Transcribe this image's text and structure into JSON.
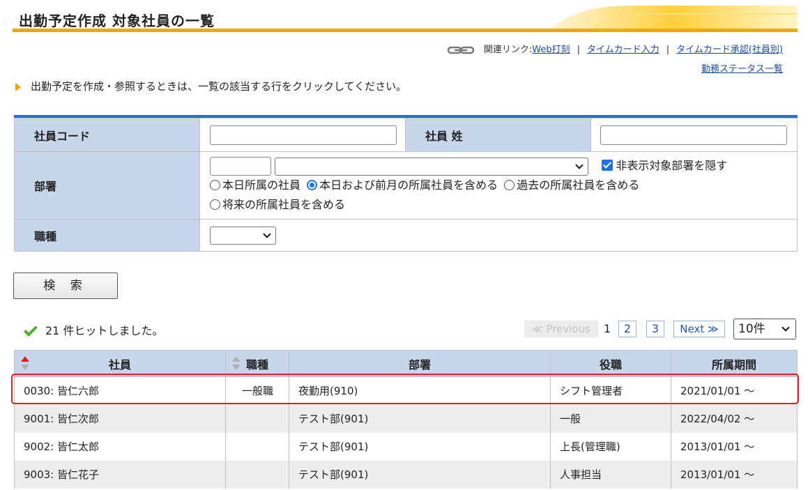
{
  "header": {
    "title": "出勤予定作成 対象社員の一覧"
  },
  "related_links": {
    "label": "関連リンク:",
    "items": [
      "Web打刻",
      "タイムカード入力",
      "タイムカード承認(社員別)",
      "勤務ステータス一覧"
    ],
    "separator": "|"
  },
  "instruction": "出勤予定を作成・参照するときは、一覧の該当する行をクリックしてください。",
  "search_form": {
    "employee_code_label": "社員コード",
    "employee_code_value": "",
    "employee_surname_label": "社員 姓",
    "employee_surname_value": "",
    "department_label": "部署",
    "department_code_value": "",
    "department_select_value": "",
    "hide_hidden_departments": {
      "label": "非表示対象部署を隠す",
      "checked": true
    },
    "membership_options": [
      {
        "label": "本日所属の社員",
        "selected": false
      },
      {
        "label": "本日および前月の所属社員を含める",
        "selected": true
      },
      {
        "label": "過去の所属社員を含める",
        "selected": false
      },
      {
        "label": "将来の所属社員を含める",
        "selected": false
      }
    ],
    "job_type_label": "職種",
    "job_type_value": "",
    "search_button": "検 索"
  },
  "results": {
    "hit_text": "21 件ヒットしました。",
    "pagination": {
      "previous": "≪ Previous",
      "current": "1",
      "pages": [
        "2",
        "3"
      ],
      "next": "Next ≫",
      "page_size": "10件"
    },
    "columns": [
      "社員",
      "職種",
      "部署",
      "役職",
      "所属期間"
    ],
    "rows": [
      {
        "employee": "0030:  皆仁六郎",
        "job_type": "一般職",
        "department": "夜勤用(910)",
        "position": "シフト管理者",
        "period": "2021/01/01 〜"
      },
      {
        "employee": "9001:  皆仁次郎",
        "job_type": "",
        "department": "テスト部(901)",
        "position": "一般",
        "period": "2022/04/02 〜"
      },
      {
        "employee": "9002:  皆仁太郎",
        "job_type": "",
        "department": "テスト部(901)",
        "position": "上長(管理職)",
        "period": "2013/01/01 〜"
      },
      {
        "employee": "9003:  皆仁花子",
        "job_type": "",
        "department": "テスト部(901)",
        "position": "人事担当",
        "period": "2013/01/01 〜"
      }
    ]
  },
  "colors": {
    "accent": "#f0a900",
    "form_top_border": "#2a6bd6",
    "label_bg": "#c7d6ea",
    "highlight": "#e02020"
  }
}
